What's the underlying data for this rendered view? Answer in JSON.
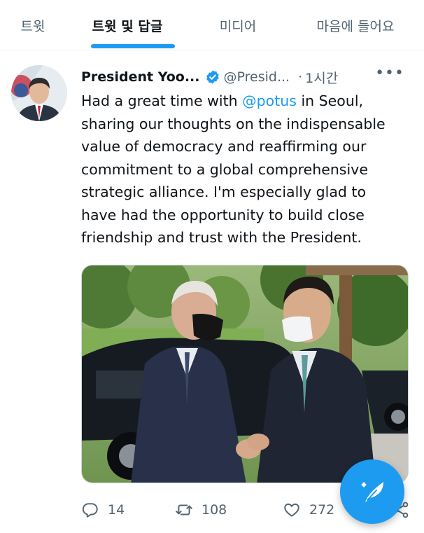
{
  "tabs": [
    {
      "label": "트윗",
      "active": false
    },
    {
      "label": "트윗 및 답글",
      "active": true
    },
    {
      "label": "미디어",
      "active": false
    },
    {
      "label": "마음에 들어요",
      "active": false
    }
  ],
  "tweet": {
    "display_name": "President Yoo...",
    "handle": "@Presid...",
    "separator": "·",
    "time": "1시간",
    "verified": true,
    "text_lines": [
      {
        "before": "Had a great time with ",
        "mention": "@potus",
        "after": " in Seoul,"
      },
      {
        "text": "sharing our thoughts on the indispensable"
      },
      {
        "text": "value of democracy and reaffirming our"
      },
      {
        "text": "commitment to a global comprehensive"
      },
      {
        "text": "strategic alliance. I'm especially glad to"
      },
      {
        "text": "have had the opportunity to build close"
      },
      {
        "text": "friendship and trust with the President."
      }
    ],
    "actions": {
      "reply_count": "14",
      "retweet_count": "108",
      "like_count": "272"
    }
  },
  "icons": {
    "verified": "verified-badge-icon",
    "more": "more-options-icon",
    "reply": "reply-icon",
    "retweet": "retweet-icon",
    "like": "heart-icon",
    "share": "share-icon",
    "compose": "compose-tweet-icon"
  },
  "colors": {
    "accent": "#1d9bf0",
    "text_primary": "#0f1419",
    "text_secondary": "#536471"
  }
}
